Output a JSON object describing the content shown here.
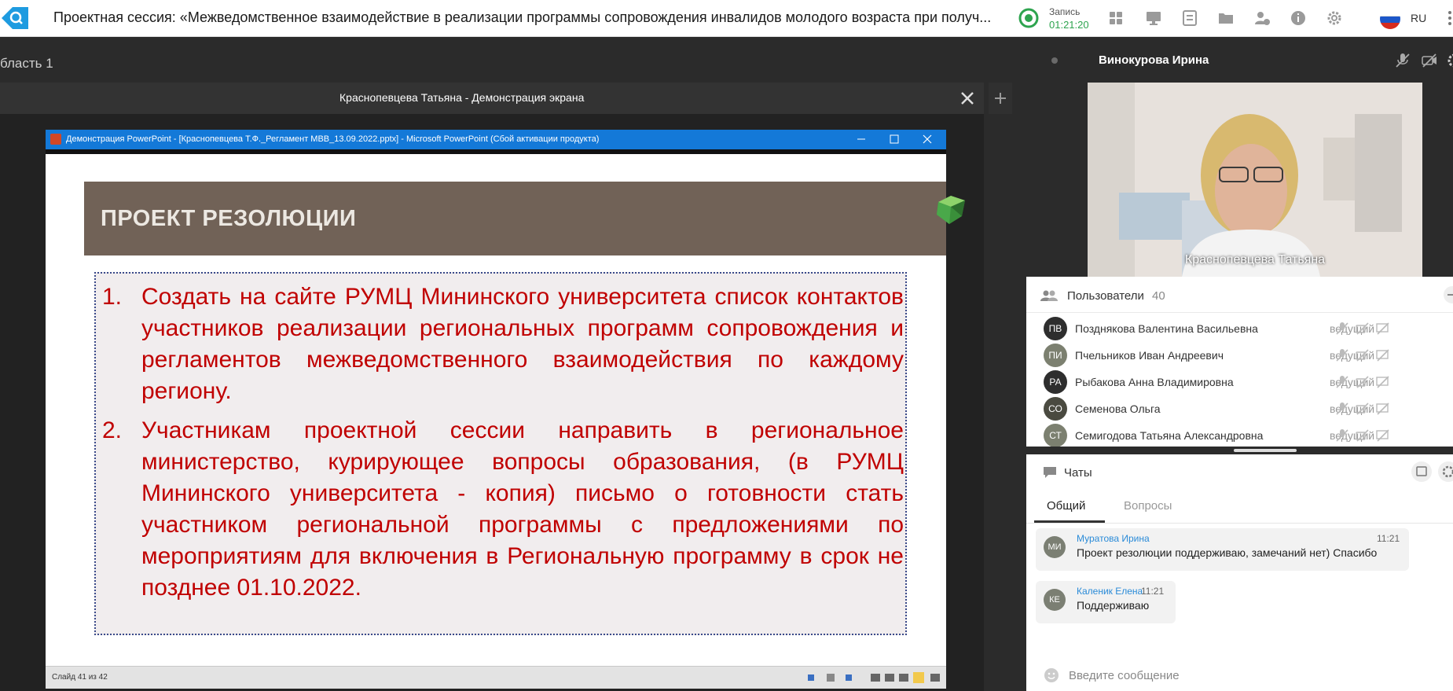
{
  "header": {
    "title": "Проектная сессия: «Межведомственное взаимодействие в реализации программы сопровождения инвалидов молодого возраста при получ...",
    "record_label": "Запись",
    "record_time": "01:21:20",
    "language": "RU"
  },
  "workspace": {
    "area_label": "бласть 1",
    "share_title": "Краснопевцева Татьяна - Демонстрация экрана"
  },
  "ppt": {
    "window_title": "Демонстрация PowerPoint - [Краснопевцева Т.Ф._Регламент МВВ_13.09.2022.pptx] - Microsoft PowerPoint (Сбой активации продукта)",
    "status": "Слайд 41 из 42",
    "slide": {
      "heading": "ПРОЕКТ РЕЗОЛЮЦИИ",
      "items": [
        {
          "num": "1.",
          "text": "Создать на сайте РУМЦ Мининского университета список контактов участников  реализации региональных программ сопровождения и регламентов межведомственного взаимодействия по каждому региону."
        },
        {
          "num": "2.",
          "text": "Участникам проектной сессии направить в региональное министерство, курирующее вопросы образования, (в РУМЦ Мининского университета - копия) письмо о готовности стать участником региональной программы с предложениями по мероприятиям для включения в Региональную программу в срок не позднее 01.10.2022."
        }
      ]
    }
  },
  "video": {
    "speaker": "Винокурова Ирина",
    "label": "Краснопевцева Татьяна"
  },
  "users": {
    "title": "Пользователи",
    "count": "40",
    "list": [
      {
        "initials": "ПВ",
        "name": "Позднякова Валентина Васильевна",
        "role": "ведущий",
        "color": "#2e2e2e"
      },
      {
        "initials": "ПИ",
        "name": "Пчельников Иван Андреевич",
        "role": "ведущий",
        "color": "#7c8070"
      },
      {
        "initials": "РА",
        "name": "Рыбакова Анна Владимировна",
        "role": "ведущий",
        "color": "#2e2e2e"
      },
      {
        "initials": "СО",
        "name": "Семенова Ольга",
        "role": "ведущий",
        "color": "#4a4a40"
      },
      {
        "initials": "СТ",
        "name": "Семигодова Татьяна Александровна",
        "role": "ведущий",
        "color": "#7c8070"
      }
    ]
  },
  "chats": {
    "title": "Чаты",
    "tabs": [
      "Общий",
      "Вопросы"
    ],
    "messages": [
      {
        "initials": "МИ",
        "author": "Муратова Ирина",
        "time": "11:21",
        "text": "Проект резолюции поддерживаю, замечаний нет) Спасибо"
      },
      {
        "initials": "КЕ",
        "author": "Каленик Елена",
        "time": "11:21",
        "text": "Поддерживаю"
      }
    ],
    "input_placeholder": "Введите сообщение"
  }
}
